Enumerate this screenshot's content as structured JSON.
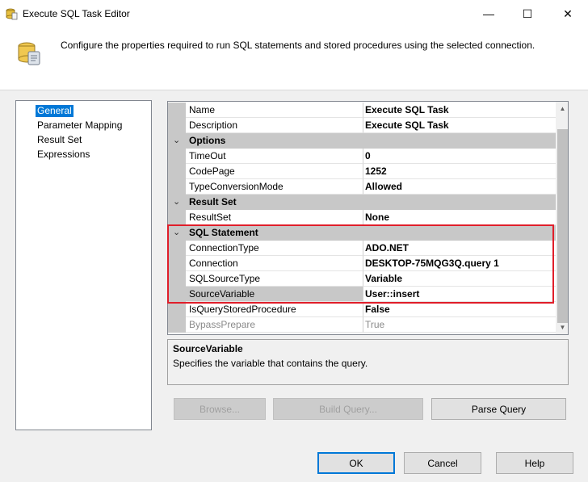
{
  "window": {
    "title": "Execute SQL Task Editor",
    "minimize_glyph": "—",
    "maximize_glyph": "☐",
    "close_glyph": "✕"
  },
  "header": {
    "text": "Configure the properties required to run SQL statements and stored procedures using the selected connection."
  },
  "nav": {
    "items": [
      "General",
      "Parameter Mapping",
      "Result Set",
      "Expressions"
    ],
    "selected": "General"
  },
  "grid": {
    "rows": [
      {
        "name": "Name",
        "value": "Execute SQL Task"
      },
      {
        "name": "Description",
        "value": "Execute SQL Task"
      }
    ],
    "categories": {
      "options": {
        "label": "Options",
        "rows": [
          {
            "name": "TimeOut",
            "value": "0"
          },
          {
            "name": "CodePage",
            "value": "1252"
          },
          {
            "name": "TypeConversionMode",
            "value": "Allowed"
          }
        ]
      },
      "result_set": {
        "label": "Result Set",
        "rows": [
          {
            "name": "ResultSet",
            "value": "None"
          }
        ]
      },
      "sql_statement": {
        "label": "SQL Statement",
        "rows": [
          {
            "name": "ConnectionType",
            "value": "ADO.NET"
          },
          {
            "name": "Connection",
            "value": "DESKTOP-75MQG3Q.query 1"
          },
          {
            "name": "SQLSourceType",
            "value": "Variable"
          },
          {
            "name": "SourceVariable",
            "value": "User::insert"
          },
          {
            "name": "IsQueryStoredProcedure",
            "value": "False"
          },
          {
            "name": "BypassPrepare",
            "value": "True"
          }
        ]
      }
    },
    "selected_row": "SourceVariable",
    "highlight_color": "#e01e2a"
  },
  "description": {
    "title": "SourceVariable",
    "text": "Specifies the variable that contains the query."
  },
  "buttons": {
    "browse": "Browse...",
    "build_query": "Build Query...",
    "parse_query": "Parse Query",
    "ok": "OK",
    "cancel": "Cancel",
    "help": "Help"
  },
  "icons": {
    "window": "sql-task-icon",
    "header": "database-scroll-icon",
    "category_expanded": "chevron-down-icon"
  },
  "colors": {
    "selection": "#0078d7",
    "category_band": "#c8c8c8"
  }
}
